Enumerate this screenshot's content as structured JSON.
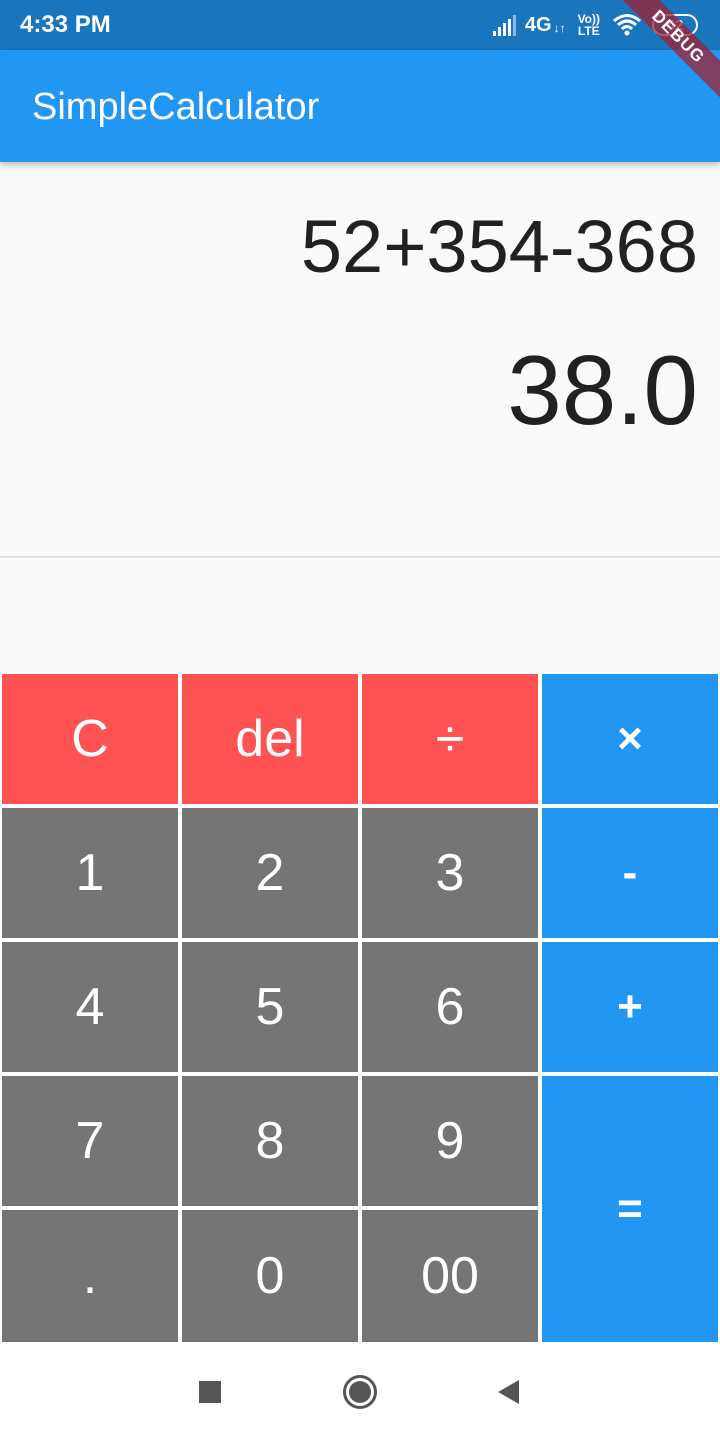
{
  "status_bar": {
    "time": "4:33 PM",
    "network": "4G",
    "network_arrows": "↓↑",
    "volte_top": "Vo))",
    "volte_bottom": "LTE",
    "battery": "42",
    "icons": [
      "signal-icon",
      "wifi-icon",
      "battery-icon"
    ]
  },
  "debug_banner": "DEBUG",
  "app_bar": {
    "title": "SimpleCalculator"
  },
  "display": {
    "expression": "52+354-368",
    "result": "38.0"
  },
  "keypad": {
    "clear": "C",
    "delete": "del",
    "divide": "÷",
    "multiply": "×",
    "one": "1",
    "two": "2",
    "three": "3",
    "minus": "-",
    "four": "4",
    "five": "5",
    "six": "6",
    "plus": "+",
    "seven": "7",
    "eight": "8",
    "nine": "9",
    "equals": "=",
    "dot": ".",
    "zero": "0",
    "double_zero": "00"
  },
  "nav_bar": {
    "icons": [
      "recents-square-icon",
      "home-circle-icon",
      "back-triangle-icon"
    ]
  },
  "colors": {
    "status_bar": "#1a75bf",
    "app_bar": "#2196f3",
    "clear_keys": "#ff5252",
    "number_keys": "#757575",
    "operator_keys": "#2196f3",
    "background": "#fafafa"
  }
}
